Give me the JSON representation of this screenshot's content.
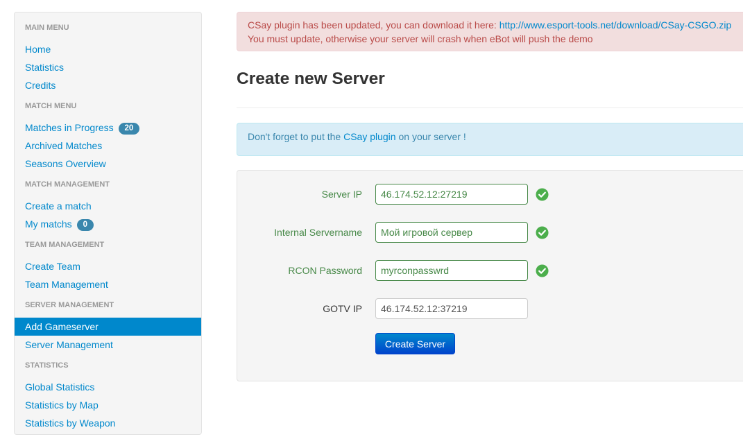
{
  "sidebar": {
    "sections": [
      {
        "header": "MAIN MENU",
        "items": [
          "Home",
          "Statistics",
          "Credits"
        ]
      },
      {
        "header": "MATCH MENU",
        "items": [
          "Matches in Progress",
          "Archived Matches",
          "Seasons Overview"
        ]
      },
      {
        "header": "MATCH MANAGEMENT",
        "items": [
          "Create a match",
          "My matchs"
        ]
      },
      {
        "header": "TEAM MANAGEMENT",
        "items": [
          "Create Team",
          "Team Management"
        ]
      },
      {
        "header": "SERVER MANAGEMENT",
        "items": [
          "Add Gameserver",
          "Server Management"
        ]
      },
      {
        "header": "STATISTICS",
        "items": [
          "Global Statistics",
          "Statistics by Map",
          "Statistics by Weapon"
        ]
      }
    ],
    "badges": {
      "matches_in_progress": "20",
      "my_matchs": "0"
    },
    "active_item": "Add Gameserver"
  },
  "alert_error": {
    "line1_text": "CSay plugin has been updated, you can download it here: ",
    "line1_link": "http://www.esport-tools.net/download/CSay-CSGO.zip",
    "line2": "You must update, otherwise your server will crash when eBot will push the demo"
  },
  "page_title": "Create new Server",
  "alert_info": {
    "prefix": "Don't forget to put the ",
    "link": "CSay plugin",
    "suffix": " on your server !"
  },
  "form": {
    "fields": [
      {
        "label": "Server IP",
        "value": "46.174.52.12:27219",
        "valid": true
      },
      {
        "label": "Internal Servername",
        "value": "Мой игровой сервер",
        "valid": true
      },
      {
        "label": "RCON Password",
        "value": "myrconpasswrd",
        "valid": true
      },
      {
        "label": "GOTV IP",
        "value": "46.174.52.12:37219",
        "valid": false
      }
    ],
    "submit_label": "Create Server"
  },
  "colors": {
    "link": "#0088cc",
    "active_bg": "#0088cc",
    "badge": "#3a87ad",
    "success": "#468847",
    "success_icon": "#4cae4c",
    "error_text": "#b94a48",
    "error_bg": "#f2dede",
    "info_text": "#3a87ad",
    "info_bg": "#d9edf7"
  },
  "icons": {
    "valid": "check-circle-icon"
  }
}
